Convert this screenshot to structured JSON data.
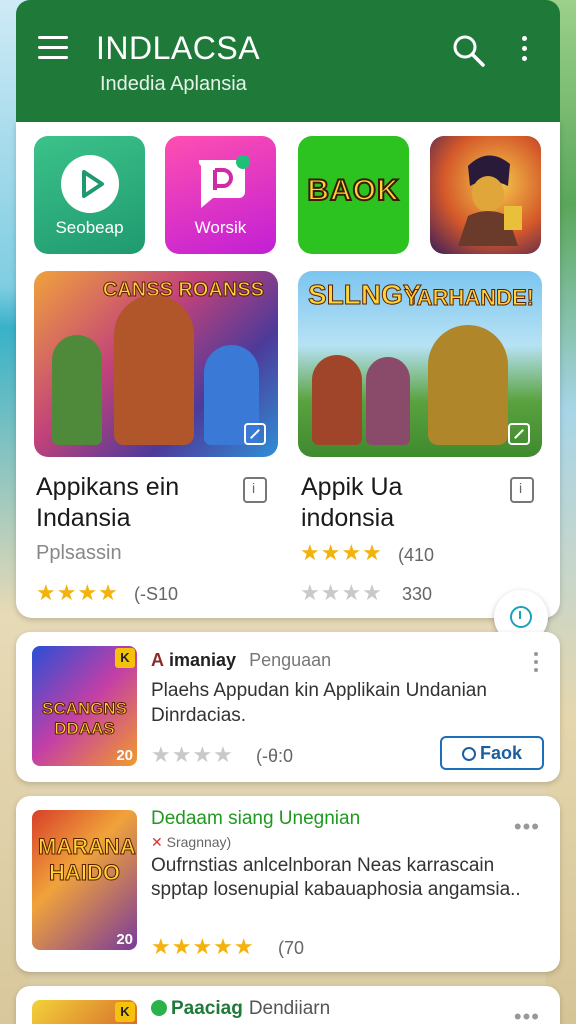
{
  "header": {
    "title": "INDLACSA",
    "subtitle": "Indedia Aplansia"
  },
  "top_icons": [
    {
      "label": "Seobeap"
    },
    {
      "label": "Worsik"
    },
    {
      "label": "BAOK"
    },
    {
      "label": ""
    }
  ],
  "featured": [
    {
      "banner": "CANSS ROANSS",
      "title": "Appikans ein Indansia",
      "meta": "Pplsassin",
      "stars_filled": 4,
      "rating": "(-S10"
    },
    {
      "banner": "SLLNGY",
      "banner2": "YARHANDE!",
      "title": "Appik Ua indonsia",
      "meta_rating": "(410",
      "stars_filled": 4,
      "rating": "330"
    }
  ],
  "list": [
    {
      "thumb_badge": "K",
      "thumb_title": "SCANGNS DDAAS",
      "thumb_num": "20",
      "developer": "imaniay",
      "category": "Penguaan",
      "description": "Plaehs Appudan kin Applikain Undanian Dinrdacias.",
      "stars_filled": 0,
      "rating": "(-θ:0",
      "button_label": "Faok"
    },
    {
      "thumb_title": "MARANA HAIDO",
      "thumb_num": "20",
      "title": "Dedaam siang Unegnian",
      "sub": "Sragnnay)",
      "description": "Oufrnstias anlcelnboran Neas karrascain spptap losenupial kabauaphosia angamsia..",
      "stars_filled": 5,
      "rating": "(70"
    },
    {
      "thumb_badge": "K",
      "title": "Paaciag",
      "developer": "Dendiiarn"
    }
  ],
  "colors": {
    "header_bg": "#1f7a3a",
    "star": "#f4b20c",
    "link": "#1c5fa0"
  }
}
